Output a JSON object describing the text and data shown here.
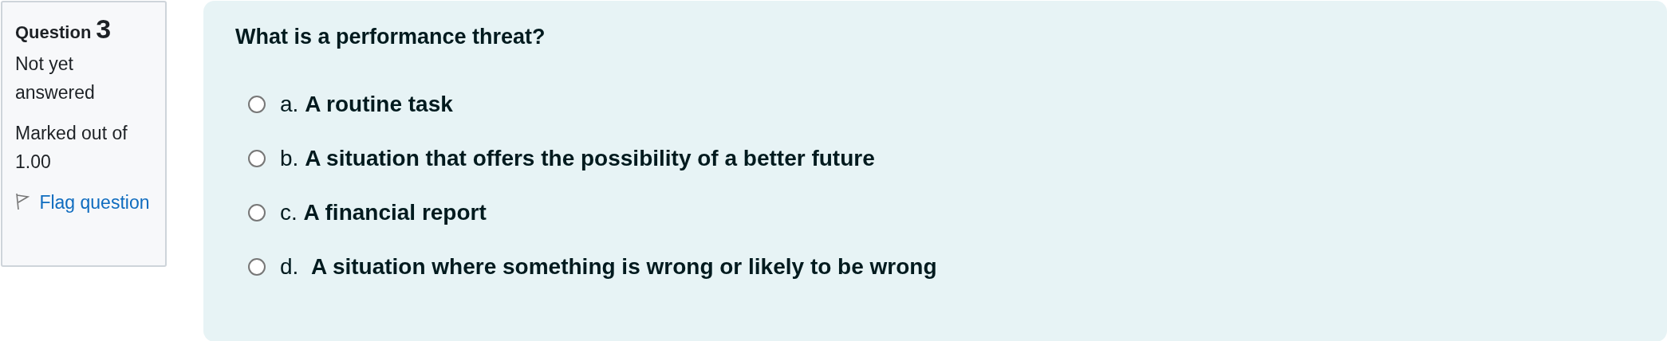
{
  "info": {
    "label": "Question",
    "number": "3",
    "state": "Not yet answered",
    "marks": "Marked out of 1.00",
    "flag_link": "Flag question"
  },
  "question": {
    "text": "What is a performance threat?",
    "options": [
      {
        "label": "a. **A routine task**",
        "selected": false
      },
      {
        "label": "b. **A situation that offers the possibility of a better future**",
        "selected": false
      },
      {
        "label": "c. **A financial report**",
        "selected": false
      },
      {
        "label": "d.  **A situation where something is wrong or likely to be wrong**",
        "selected": false
      }
    ]
  }
}
